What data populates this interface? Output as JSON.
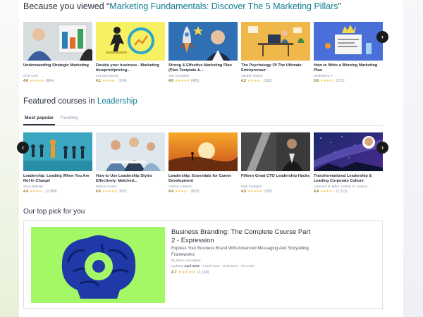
{
  "because_section": {
    "prefix": "Because you viewed “",
    "course_link": "Marketing Fundamentals: Discover The 5 Marketing Pillars",
    "suffix": "”"
  },
  "because_cards": [
    {
      "title": "Understanding Strategic Marketing",
      "author": "Chris Croft",
      "rating": "4.6",
      "stars": "★★★★★",
      "count": "(864)"
    },
    {
      "title": "Double your business - Marketing blueprint/pricing...",
      "author": "Krisztina Rudnay",
      "rating": "4.1",
      "stars": "★★★★☆",
      "count": "(334)"
    },
    {
      "title": "Strong & Effective Marketing Plan (Plan Template &...",
      "author": "Alex Genadinik",
      "rating": "4.6",
      "stars": "★★★★★",
      "count": "(485)"
    },
    {
      "title": "The Psychology Of The Ultimate Entrepreneur",
      "author": "Vladimir Raykov",
      "rating": "4.2",
      "stars": "★★★★☆",
      "count": "(393)"
    },
    {
      "title": "How to Write a Winning Marketing Plan",
      "author": "MindMekka ®",
      "rating": "3.8",
      "stars": "★★★★☆",
      "count": "(323)"
    }
  ],
  "featured_section": {
    "prefix": "Featured courses in ",
    "topic_link": "Leadership"
  },
  "tabs": [
    {
      "label": "Most popular",
      "active": true
    },
    {
      "label": "Trending",
      "active": false
    }
  ],
  "featured_cards": [
    {
      "title": "Leadership: Leading When You Are Not In Charge!",
      "author": "Steve Ballinger",
      "rating": "4.4",
      "stars": "★★★★☆",
      "count": "(2,384)"
    },
    {
      "title": "How to Use Leadership Styles Effectively: Matched...",
      "author": "Markus Amanto",
      "rating": "4.5",
      "stars": "★★★★★",
      "count": "(959)"
    },
    {
      "title": "Leadership: Essentials for Career Development",
      "author": "Andrew LoMastro",
      "rating": "4.4",
      "stars": "★★★★☆",
      "count": "(823)"
    },
    {
      "title": "Fifteen Great CTO Leadership Hacks",
      "author": "Mark Farragher",
      "rating": "4.5",
      "stars": "★★★★★",
      "count": "(338)"
    },
    {
      "title": "Transformational Leadership & Leading Corporate Culture",
      "author": "Lawrence M. Miller, Institute for Leaders...",
      "rating": "4.4",
      "stars": "★★★★☆",
      "count": "(2,311)"
    }
  ],
  "top_pick": {
    "heading": "Our top pick for you",
    "title": "Business Branding: The Complete Course Part 2 - Expression",
    "subtitle": "Express Your Business Brand With Advanced Messaging And Storytelling Frameworks",
    "author": "By Steve Houraghan",
    "updated_label": "Updated",
    "updated_date": "April 2019",
    "meta_rest": "· 4 total hours · 48 lectures · All Levels",
    "rating": "4.7",
    "stars": "★★★★★",
    "count": "(1,149)"
  },
  "arrows": {
    "next": "›",
    "prev": "‹"
  },
  "colors": {
    "link": "#0f7c90",
    "star": "#f4c150",
    "rating": "#8a6d15",
    "text": "#29303b"
  }
}
